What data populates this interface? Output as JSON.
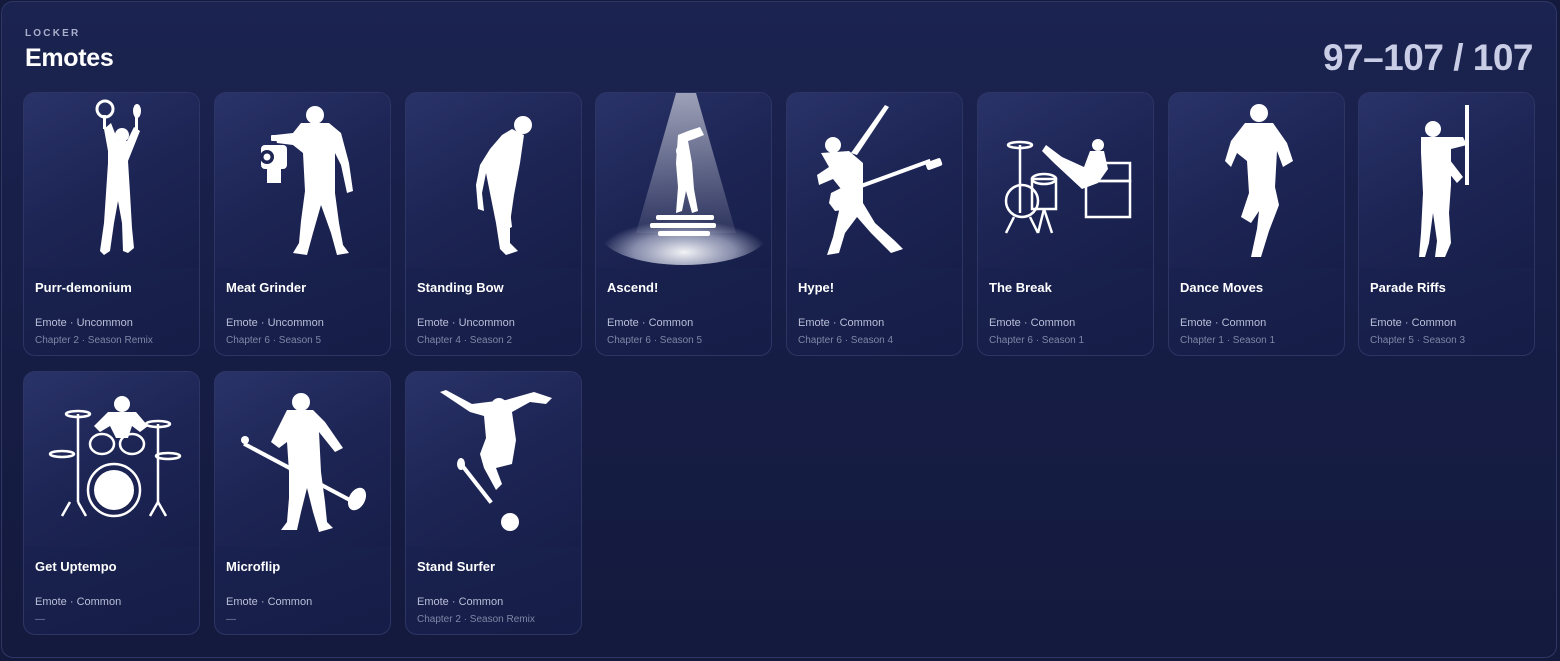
{
  "header": {
    "eyebrow": "LOCKER",
    "title": "Emotes",
    "counter": "97–107 / 107"
  },
  "items": [
    {
      "name": "Purr-demonium",
      "meta": "Emote · Uncommon",
      "sub": "Chapter 2 · Season Remix",
      "icon": "dancer-with-props-icon"
    },
    {
      "name": "Meat Grinder",
      "meta": "Emote · Uncommon",
      "sub": "Chapter 6 · Season 5",
      "icon": "meat-grinder-icon"
    },
    {
      "name": "Standing Bow",
      "meta": "Emote · Uncommon",
      "sub": "Chapter 4 · Season 2",
      "icon": "bowing-figure-icon"
    },
    {
      "name": "Ascend!",
      "meta": "Emote · Common",
      "sub": "Chapter 6 · Season 5",
      "icon": "spotlight-figure-icon"
    },
    {
      "name": "Hype!",
      "meta": "Emote · Common",
      "sub": "Chapter 6 · Season 4",
      "icon": "bass-guitar-icon"
    },
    {
      "name": "The Break",
      "meta": "Emote · Common",
      "sub": "Chapter 6 · Season 1",
      "icon": "drum-kit-icon"
    },
    {
      "name": "Dance Moves",
      "meta": "Emote · Common",
      "sub": "Chapter 1 · Season 1",
      "icon": "dancing-figure-icon"
    },
    {
      "name": "Parade Riffs",
      "meta": "Emote · Common",
      "sub": "Chapter 5 · Season 3",
      "icon": "parade-figure-icon"
    },
    {
      "name": "Get Uptempo",
      "meta": "Emote · Common",
      "sub": "—",
      "icon": "drummer-icon"
    },
    {
      "name": "Microflip",
      "meta": "Emote · Common",
      "sub": "—",
      "icon": "mic-stand-icon"
    },
    {
      "name": "Stand Surfer",
      "meta": "Emote · Common",
      "sub": "Chapter 2 · Season Remix",
      "icon": "mic-stand-surfer-icon"
    }
  ]
}
